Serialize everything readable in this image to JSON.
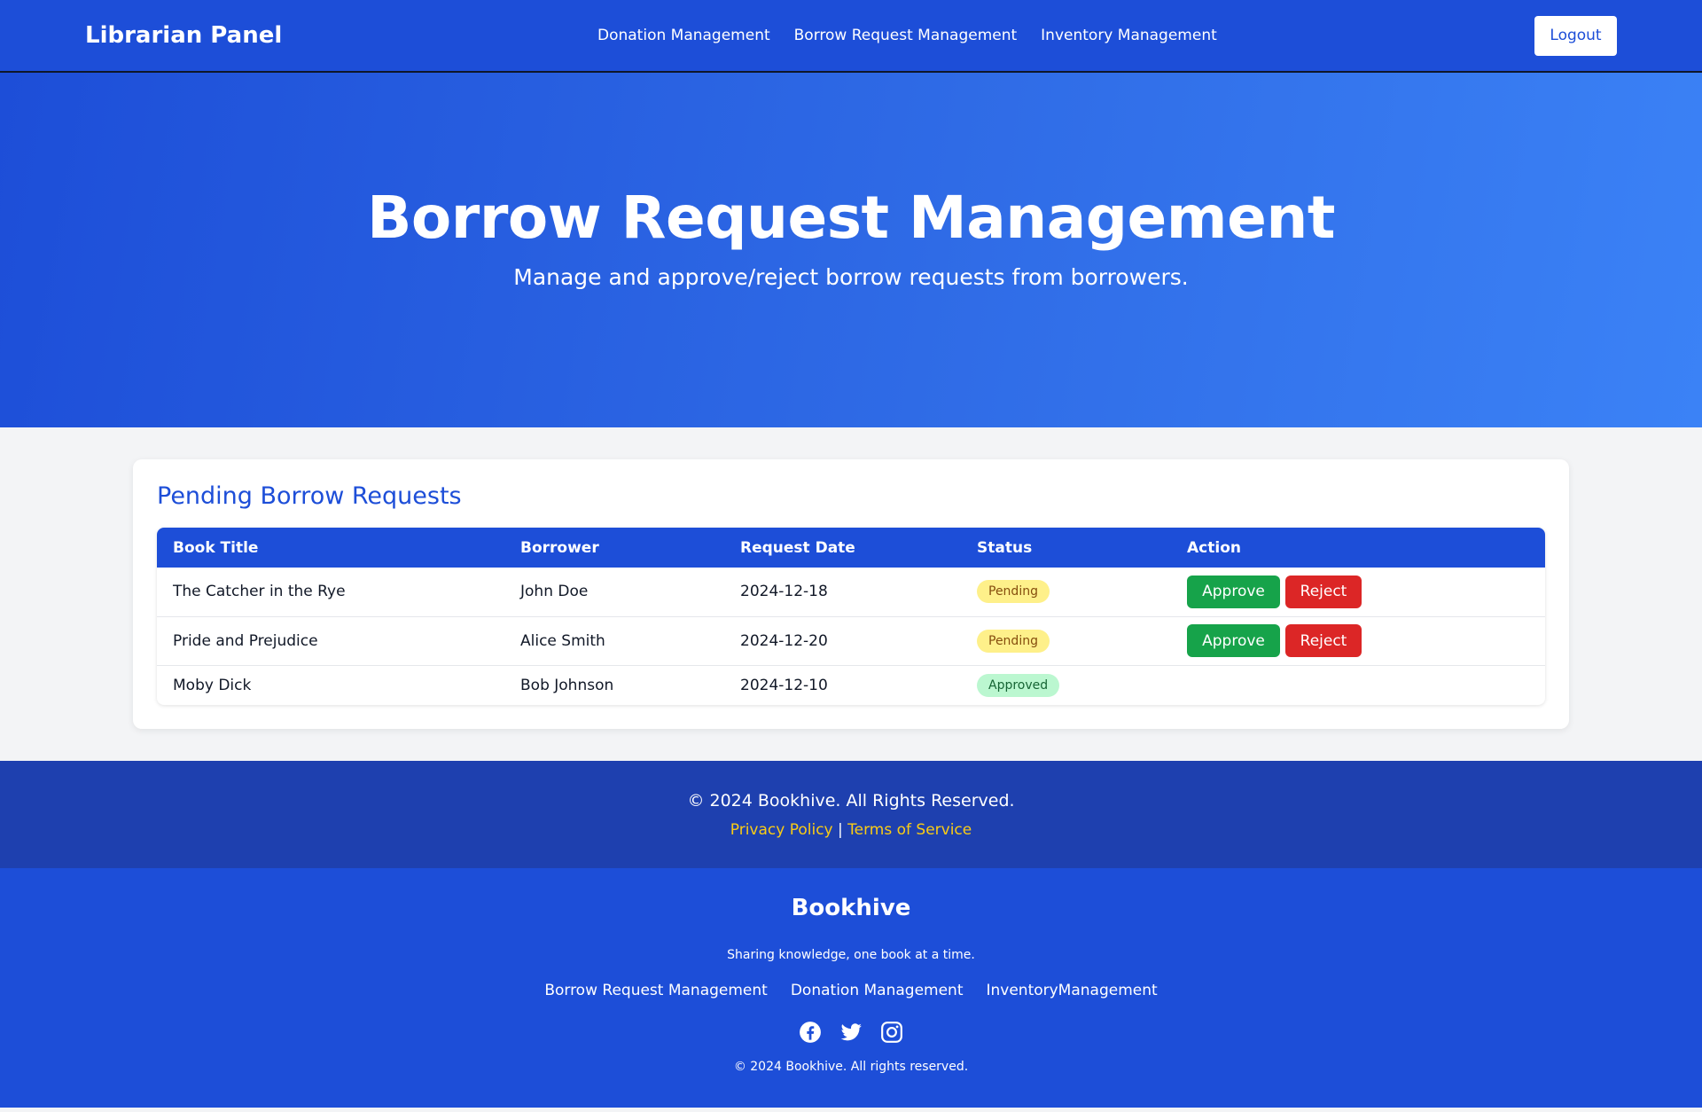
{
  "navbar": {
    "brand": "Librarian Panel",
    "links": [
      "Donation Management",
      "Borrow Request Management",
      "Inventory Management"
    ],
    "logout_label": "Logout"
  },
  "hero": {
    "title": "Borrow Request Management",
    "subtitle": "Manage and approve/reject borrow requests from borrowers."
  },
  "requests": {
    "heading": "Pending Borrow Requests",
    "columns": [
      "Book Title",
      "Borrower",
      "Request Date",
      "Status",
      "Action"
    ],
    "rows": [
      {
        "title": "The Catcher in the Rye",
        "borrower": "John Doe",
        "date": "2024-12-18",
        "status": "Pending"
      },
      {
        "title": "Pride and Prejudice",
        "borrower": "Alice Smith",
        "date": "2024-12-20",
        "status": "Pending"
      },
      {
        "title": "Moby Dick",
        "borrower": "Bob Johnson",
        "date": "2024-12-10",
        "status": "Approved"
      }
    ],
    "approve_label": "Approve",
    "reject_label": "Reject"
  },
  "footer_top": {
    "copyright": "© 2024 Bookhive. All Rights Reserved.",
    "privacy": "Privacy Policy",
    "separator": "|",
    "terms": "Terms of Service"
  },
  "footer_bottom": {
    "brand": "Bookhive",
    "tagline": "Sharing knowledge, one book at a time.",
    "links": [
      "Borrow Request Management",
      "Donation Management",
      "InventoryManagement"
    ],
    "socials": [
      "facebook-icon",
      "twitter-icon",
      "instagram-icon"
    ],
    "copyright": "© 2024 Bookhive. All rights reserved."
  },
  "colors": {
    "primary": "#1d4ed8",
    "footer_dark": "#1e40af",
    "approve": "#16a34a",
    "reject": "#dc2626",
    "link_yellow": "#facc15"
  }
}
